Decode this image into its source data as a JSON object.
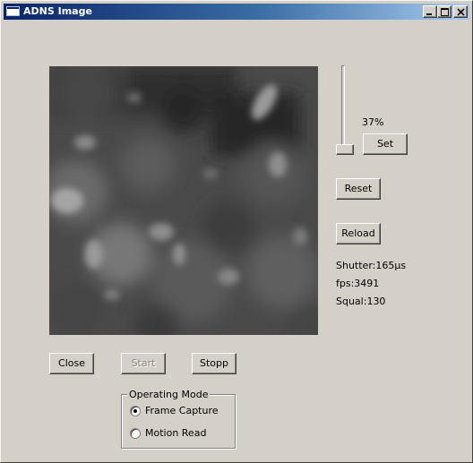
{
  "window": {
    "title": "ADNS Image"
  },
  "title_controls": {
    "minimize_icon": "minimize-icon",
    "maximize_icon": "maximize-icon",
    "close_icon": "close-icon"
  },
  "shutter_slider": {
    "percent_text": "37%",
    "level_fraction": 0.0
  },
  "buttons": {
    "set": "Set",
    "reset": "Reset",
    "reload": "Reload",
    "close": "Close",
    "start": "Start",
    "stopp": "Stopp"
  },
  "stats": {
    "shutter": "Shutter:165µs",
    "fps": "fps:3491",
    "squal": "Squal:130"
  },
  "operating_mode": {
    "legend": "Operating Mode",
    "options": [
      {
        "label": "Frame Capture",
        "selected": true
      },
      {
        "label": "Motion Read",
        "selected": false
      }
    ]
  },
  "colors": {
    "window_bg": "#d4d0c8",
    "titlebar_start": "#0a246a",
    "titlebar_end": "#a6caf0"
  }
}
